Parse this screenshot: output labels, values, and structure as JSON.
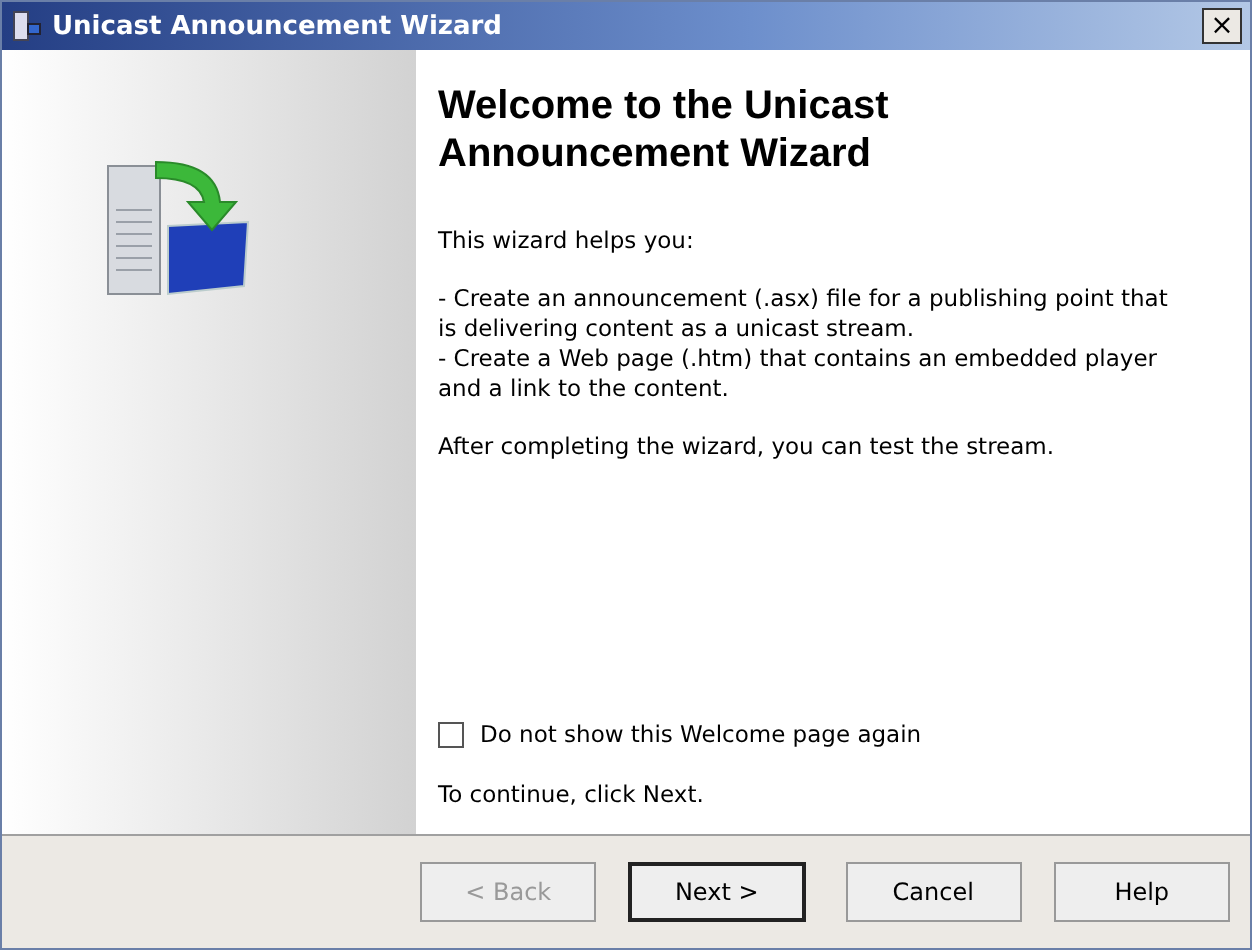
{
  "window": {
    "title": "Unicast Announcement Wizard",
    "close": "×"
  },
  "heading": "Welcome to the Unicast Announcement Wizard",
  "intro": "This wizard helps you:",
  "bullets": [
    "- Create an announcement (.asx) file for a publishing point that is delivering content as a unicast stream.",
    "- Create a Web page (.htm) that contains an embedded player and a link to the content."
  ],
  "outro": "After completing the wizard, you can test the stream.",
  "checkbox": {
    "label": "Do not show this Welcome page again",
    "checked": false
  },
  "continue_text": "To continue, click Next.",
  "buttons": [
    {
      "label": "< Back",
      "disabled": true,
      "default": false
    },
    {
      "label": "Next >",
      "disabled": false,
      "default": true
    },
    {
      "label": "Cancel",
      "disabled": false,
      "default": false
    },
    {
      "label": "Help",
      "disabled": false,
      "default": false
    }
  ]
}
